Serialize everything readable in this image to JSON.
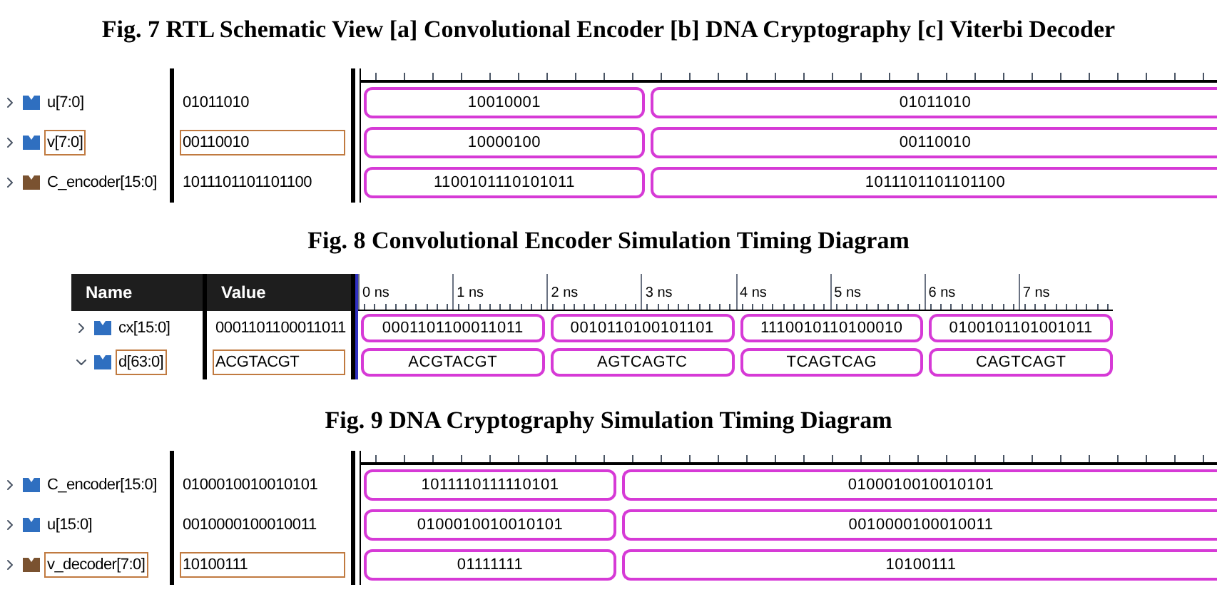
{
  "captions": [
    "Fig. 7 RTL Schematic View [a] Convolutional Encoder [b] DNA Cryptography [c] Viterbi Decoder",
    "Fig. 8 Convolutional Encoder Simulation Timing Diagram",
    "Fig. 9 DNA Cryptography Simulation Timing Diagram"
  ],
  "panels": [
    {
      "kind": "plain",
      "rows": [
        {
          "name": "u[7:0]",
          "value": "01011010",
          "expanded": false,
          "selected": false,
          "color": "#2f6fc0",
          "segments": [
            "10010001",
            "01011010"
          ]
        },
        {
          "name": "v[7:0]",
          "value": "00110010",
          "expanded": false,
          "selected": true,
          "color": "#2f6fc0",
          "segments": [
            "10000100",
            "00110010"
          ]
        },
        {
          "name": "C_encoder[15:0]",
          "value": "1011101101101100",
          "expanded": false,
          "selected": false,
          "color": "#7a5230",
          "segments": [
            "1100101110101011",
            "1011101101101100"
          ]
        }
      ]
    },
    {
      "kind": "header",
      "header": {
        "name": "Name",
        "value": "Value"
      },
      "ticks": [
        "0 ns",
        "1 ns",
        "2 ns",
        "3 ns",
        "4 ns",
        "5 ns",
        "6 ns",
        "7 ns"
      ],
      "rows": [
        {
          "name": "cx[15:0]",
          "value": "0001101100011011",
          "expanded": false,
          "selected": false,
          "color": "#2f6fc0",
          "segments": [
            "0001101100011011",
            "0010110100101101",
            "1110010110100010",
            "0100101101001011"
          ]
        },
        {
          "name": "d[63:0]",
          "value": "ACGTACGT",
          "expanded": true,
          "selected": true,
          "color": "#2f6fc0",
          "segments": [
            "ACGTACGT",
            "AGTCAGTC",
            "TCAGTCAG",
            "CAGTCAGT"
          ]
        }
      ]
    },
    {
      "kind": "plain",
      "rows": [
        {
          "name": "C_encoder[15:0]",
          "value": "0100010010010101",
          "expanded": false,
          "selected": false,
          "color": "#2f6fc0",
          "segments": [
            "1011110111110101",
            "0100010010010101"
          ]
        },
        {
          "name": "u[15:0]",
          "value": "0010000100010011",
          "expanded": false,
          "selected": false,
          "color": "#2f6fc0",
          "segments": [
            "0100010010010101",
            "0010000100010011"
          ]
        },
        {
          "name": "v_decoder[7:0]",
          "value": "10100111",
          "expanded": false,
          "selected": true,
          "color": "#7a5230",
          "segments": [
            "01111111",
            "10100111"
          ]
        }
      ]
    }
  ]
}
